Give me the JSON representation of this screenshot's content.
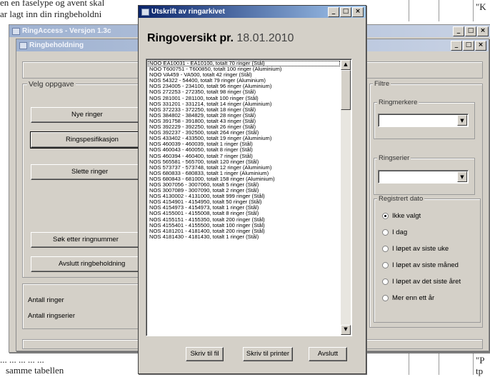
{
  "background_doc": {
    "top_lines": [
      "en en faselype og avent skal",
      "ar lagt inn din ringbeholdni"
    ],
    "bottom_lines": [
      "... ... ... ... ...",
      "samme tabellen"
    ],
    "right_marks": [
      "\"K",
      "\"P",
      "tp"
    ]
  },
  "app_window": {
    "title": "RingAccess - Versjon 1.3c",
    "controls": [
      "_",
      "□",
      "×"
    ]
  },
  "inner_window": {
    "title": "Ringbeholdning",
    "controls": [
      "_",
      "□",
      "×"
    ],
    "velg_label": "Velg oppgave",
    "buttons": [
      "Nye ringer",
      "Ringspesifikasjon",
      "Slette ringer",
      "Søk etter ringnummer",
      "Avslutt ringbeholdning"
    ],
    "antall_ringer": "Antall ringer",
    "antall_ringserier": "Antall ringserier",
    "filter_label": "Filtre",
    "ringmerkere_label": "Ringmerkere",
    "ringserier_label": "Ringserier",
    "registrert_label": "Registrert dato",
    "date_options": [
      {
        "label": "Ikke valgt",
        "selected": true
      },
      {
        "label": "I dag",
        "selected": false
      },
      {
        "label": "I løpet av siste uke",
        "selected": false
      },
      {
        "label": "I løpet av siste måned",
        "selected": false
      },
      {
        "label": "I løpet av det siste året",
        "selected": false
      },
      {
        "label": "Mer enn ett år",
        "selected": false
      }
    ]
  },
  "dialog": {
    "title": "Utskrift av ringarkivet",
    "controls": [
      "_",
      "□",
      "×"
    ],
    "heading_label": "Ringoversikt pr.",
    "heading_date": "18.01.2010",
    "list_items": [
      "NOO EA10031 - EA10100, totalt 70 ringer (Stål)",
      "NOO T600751 - T600850, totalt 100 ringer (Aluminium)",
      "NOO VA459 - VA500, totalt 42 ringer (Stål)",
      "NOS 54322 - 54400, totalt 79 ringer (Aluminium)",
      "NOS 234005 - 234100, totalt 96 ringer (Aluminium)",
      "NOS 272253 - 272350, totalt 98 ringer (Stål)",
      "NOS 281001 - 281100, totalt 100 ringer (Stål)",
      "NOS 331201 - 331214, totalt 14 ringer (Aluminium)",
      "NOS 372233 - 372250, totalt 18 ringer (Stål)",
      "NOS 384802 - 384829, totalt 28 ringer (Stål)",
      "NOS 391758 - 391800, totalt 43 ringer (Stål)",
      "NOS 392229 - 392250, totalt 26 ringer (Stål)",
      "NOS 392237 - 392500, totalt 264 ringer (Stål)",
      "NOS 433402 - 433500, totalt 19 ringer (Aluminium)",
      "NOS 460039 - 460039, totalt 1 ringer (Stål)",
      "NOS 460043 - 460050, totalt 8 ringer (Stål)",
      "NOS 460394 - 460400, totalt 7 ringer (Stål)",
      "NOS 565581 - 565700, totalt 120 ringer (Stål)",
      "NOS 573737 - 573748, totalt 12 ringer (Aluminium)",
      "NOS 680833 - 680833, totalt 1 ringer (Aluminium)",
      "NOS 680843 - 681000, totalt 158 ringer (Aluminium)",
      "NOS 3007056 - 3007060, totalt 5 ringer (Stål)",
      "NOS 3007089 - 3007090, totalt 2 ringer (Stål)",
      "NOS 4130002 - 4131000, totalt 999 ringer (Stål)",
      "NOS 4154901 - 4154950, totalt 50 ringer (Stål)",
      "NOS 4154973 - 4154973, totalt 1 ringer (Stål)",
      "NOS 4155001 - 4155008, totalt 8 ringer (Stål)",
      "NOS 4155151 - 4155350, totalt 200 ringer (Stål)",
      "NOS 4155401 - 4155500, totalt 100 ringer (Stål)",
      "NOS 4181201 - 4181400, totalt 200 ringer (Stål)",
      "NOS 4181430 - 4181430, totalt 1 ringer (Stål)"
    ],
    "btn_file": "Skriv til fil",
    "btn_printer": "Skriv til printer",
    "btn_close": "Avslutt"
  }
}
